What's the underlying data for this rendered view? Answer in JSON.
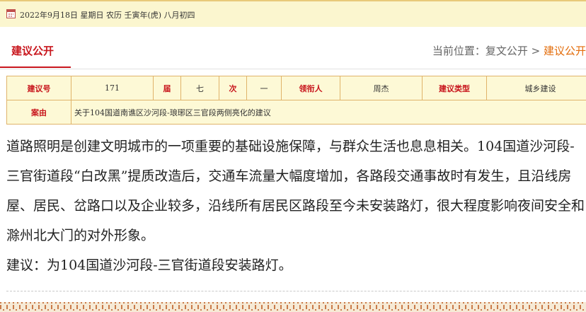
{
  "header": {
    "date_text": "2022年9月18日 星期日 农历 壬寅年(虎) 八月初四"
  },
  "nav": {
    "section_title": "建议公开",
    "location_label": "当前位置：",
    "crumb_parent": "复文公开",
    "separator": " > ",
    "crumb_current": "建议公开"
  },
  "proposal": {
    "labels": {
      "number": "建议号",
      "session": "届",
      "sitting": "次",
      "leader": "领衔人",
      "type": "建议类型",
      "subject": "案由"
    },
    "number": "171",
    "session": "七",
    "sitting": "一",
    "leader": "周杰",
    "type": "城乡建设",
    "subject": "关于104国道南谯区沙河段-琅琊区三官段两侧亮化的建议"
  },
  "content": {
    "paragraph1": "道路照明是创建文明城市的一项重要的基础设施保障，与群众生活也息息相关。104国道沙河段-三官街道段“白改黑”提质改造后，交通车流量大幅度增加，各路段交通事故时有发生，且沿线房屋、居民、岔路口以及企业较多，沿线所有居民区路段至今未安装路灯，很大程度影响夜间安全和滁州北大门的对外形象。",
    "paragraph2": "建议：为104国道沙河段-三官街道段安装路灯。"
  },
  "colors": {
    "accent_red": "#c8161d",
    "breadcrumb_orange": "#e36c0a",
    "header_bg": "#fbf6cf",
    "table_border": "#e0b36a"
  }
}
